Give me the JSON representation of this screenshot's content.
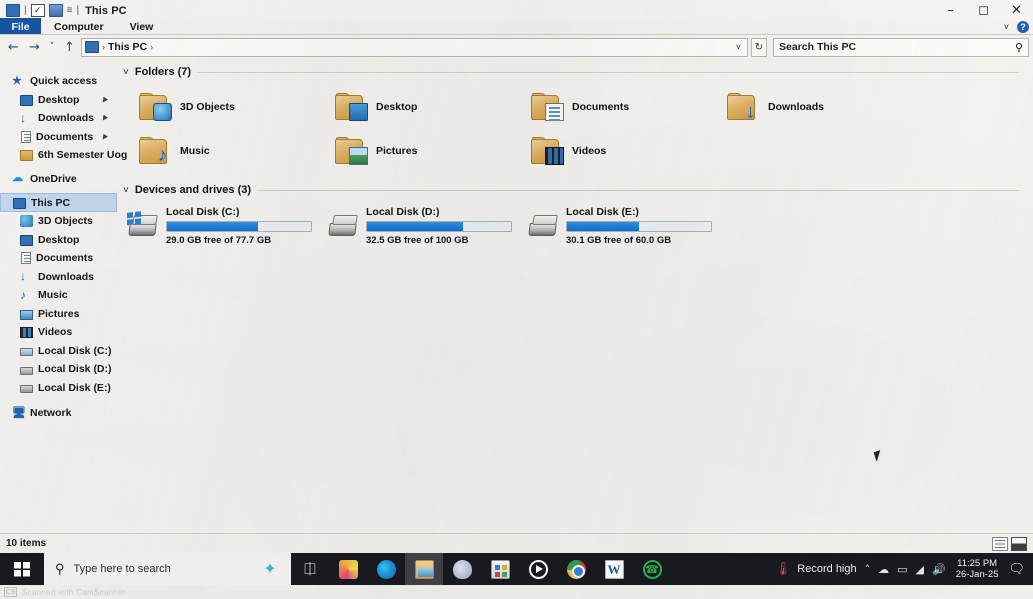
{
  "window": {
    "title": "This PC",
    "quick_access_icons": [
      "monitor-icon",
      "checkbox-icon",
      "folder-icon"
    ],
    "separator": "=",
    "minimize_label": "–",
    "maximize_label": "❐",
    "close_label": "✕",
    "ribbon_chevron": "˅",
    "help_label": "?"
  },
  "ribbon": {
    "tabs": [
      {
        "label": "File",
        "active": true
      },
      {
        "label": "Computer",
        "active": false
      },
      {
        "label": "View",
        "active": false
      }
    ]
  },
  "addressbar": {
    "back_icon": "←",
    "forward_icon": "→",
    "recent_icon": "˅",
    "up_icon": "↑",
    "breadcrumb": [
      "This PC"
    ],
    "separator": "›",
    "dropdown_icon": "˅",
    "refresh_icon": "↻"
  },
  "search": {
    "placeholder": "Search This PC",
    "icon": "⚲"
  },
  "sidebar": {
    "items": [
      {
        "label": "Quick access",
        "icon": "star-pin-icon",
        "indent": false,
        "pinned": false,
        "selected": false
      },
      {
        "label": "Desktop",
        "icon": "monitor-icon",
        "indent": true,
        "pinned": true,
        "selected": false
      },
      {
        "label": "Downloads",
        "icon": "download-icon",
        "indent": true,
        "pinned": true,
        "selected": false
      },
      {
        "label": "Documents",
        "icon": "document-icon",
        "indent": true,
        "pinned": true,
        "selected": false
      },
      {
        "label": "6th Semester Uog",
        "icon": "folder-icon",
        "indent": true,
        "pinned": false,
        "selected": false
      },
      {
        "label": "OneDrive",
        "icon": "cloud-icon",
        "indent": false,
        "pinned": false,
        "selected": false
      },
      {
        "label": "This PC",
        "icon": "monitor-icon",
        "indent": false,
        "pinned": false,
        "selected": true
      },
      {
        "label": "3D Objects",
        "icon": "cube-icon",
        "indent": true,
        "pinned": false,
        "selected": false
      },
      {
        "label": "Desktop",
        "icon": "monitor-icon",
        "indent": true,
        "pinned": false,
        "selected": false
      },
      {
        "label": "Documents",
        "icon": "document-icon",
        "indent": true,
        "pinned": false,
        "selected": false
      },
      {
        "label": "Downloads",
        "icon": "download-icon",
        "indent": true,
        "pinned": false,
        "selected": false
      },
      {
        "label": "Music",
        "icon": "music-note-icon",
        "indent": true,
        "pinned": false,
        "selected": false
      },
      {
        "label": "Pictures",
        "icon": "picture-icon",
        "indent": true,
        "pinned": false,
        "selected": false
      },
      {
        "label": "Videos",
        "icon": "video-icon",
        "indent": true,
        "pinned": false,
        "selected": false
      },
      {
        "label": "Local Disk (C:)",
        "icon": "drive-system-icon",
        "indent": true,
        "pinned": false,
        "selected": false
      },
      {
        "label": "Local Disk (D:)",
        "icon": "drive-icon",
        "indent": true,
        "pinned": false,
        "selected": false
      },
      {
        "label": "Local Disk (E:)",
        "icon": "drive-icon",
        "indent": true,
        "pinned": false,
        "selected": false
      },
      {
        "label": "Network",
        "icon": "network-icon",
        "indent": false,
        "pinned": false,
        "selected": false
      }
    ],
    "pin_glyph": "📌"
  },
  "content": {
    "folders_group": {
      "chevron": "˅",
      "title": "Folders (7)",
      "items": [
        {
          "label": "3D Objects",
          "overlay": "cube-icon"
        },
        {
          "label": "Desktop",
          "overlay": "monitor-icon"
        },
        {
          "label": "Documents",
          "overlay": "document-icon"
        },
        {
          "label": "Downloads",
          "overlay": "download-arrow-icon"
        },
        {
          "label": "Music",
          "overlay": "music-note-icon"
        },
        {
          "label": "Pictures",
          "overlay": "picture-icon"
        },
        {
          "label": "Videos",
          "overlay": "film-strip-icon"
        }
      ]
    },
    "drives_group": {
      "chevron": "˅",
      "title": "Devices and drives (3)",
      "items": [
        {
          "name": "Local Disk (C:)",
          "free_text": "29.0 GB free of 77.7 GB",
          "used_percent": 63,
          "system": true
        },
        {
          "name": "Local Disk (D:)",
          "free_text": "32.5 GB free of 100 GB",
          "used_percent": 67,
          "system": false
        },
        {
          "name": "Local Disk (E:)",
          "free_text": "30.1 GB free of 60.0 GB",
          "used_percent": 50,
          "system": false
        }
      ]
    }
  },
  "statusbar": {
    "item_count": "10 items",
    "view_details_icon": "details-view-icon",
    "view_tiles_icon": "large-icons-view-icon"
  },
  "taskbar": {
    "start_icon": "windows-logo-icon",
    "search_placeholder": "Type here to search",
    "search_icon": "⚲",
    "cortana_icon": "cortana-icon",
    "apps": [
      {
        "name": "task-view",
        "icon": "task-view-icon",
        "active": false
      },
      {
        "name": "office",
        "icon": "office-icon",
        "active": false
      },
      {
        "name": "edge",
        "icon": "edge-icon",
        "active": false
      },
      {
        "name": "file-explorer",
        "icon": "file-explorer-icon",
        "active": true
      },
      {
        "name": "paint",
        "icon": "paint-icon",
        "active": false
      },
      {
        "name": "microsoft-store",
        "icon": "store-icon",
        "active": false
      },
      {
        "name": "media-player",
        "icon": "media-player-icon",
        "active": false
      },
      {
        "name": "chrome",
        "icon": "chrome-icon",
        "active": false
      },
      {
        "name": "word",
        "icon": "word-icon",
        "active": false
      },
      {
        "name": "whatsapp",
        "icon": "whatsapp-icon",
        "active": false
      }
    ],
    "tray": {
      "weather_text": "Record high",
      "weather_icon": "🌡",
      "show_hidden_icon": "˄",
      "onedrive_icon": "☁",
      "battery_icon": "▭",
      "network_icon": "◢",
      "volume_icon": "🔊",
      "time": "11:25 PM",
      "date": "26-Jan-25",
      "action_center_icon": "▭"
    }
  },
  "watermark": {
    "badge": "CS",
    "text": "Scanned with CamScanner"
  }
}
